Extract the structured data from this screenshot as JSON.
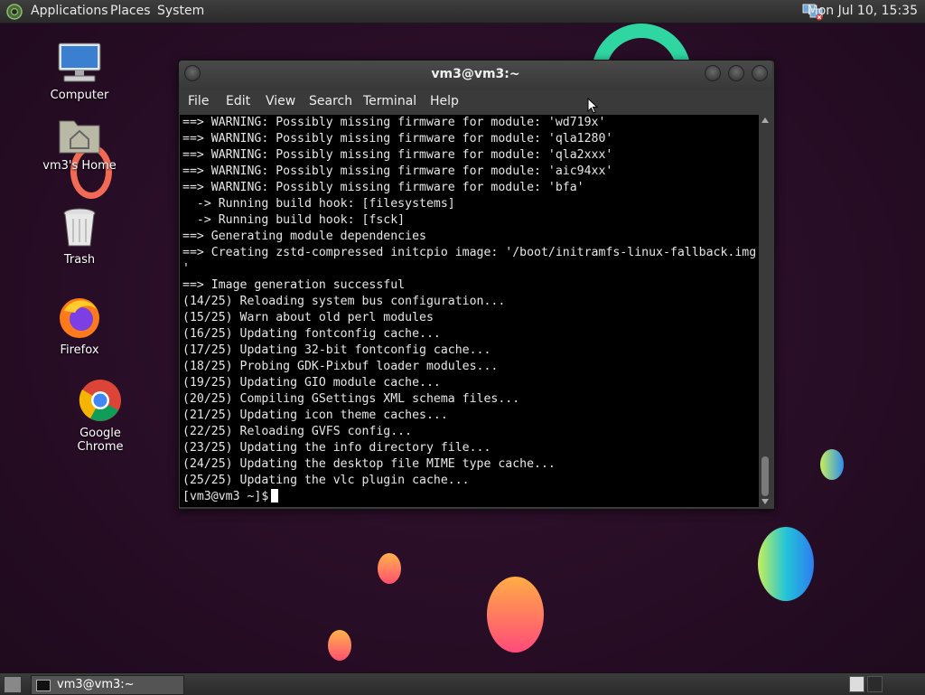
{
  "top_panel": {
    "menus": [
      "Applications",
      "Places",
      "System"
    ],
    "clock": "Mon Jul 10, 15:35"
  },
  "desktop_icons": [
    {
      "label": "Computer",
      "icon": "computer-icon"
    },
    {
      "label": "vm3's Home",
      "icon": "home-folder-icon"
    },
    {
      "label": "Trash",
      "icon": "trash-icon"
    },
    {
      "label": "Firefox",
      "icon": "firefox-icon"
    },
    {
      "label": "Google Chrome",
      "icon": "chrome-icon"
    }
  ],
  "terminal": {
    "title": "vm3@vm3:~",
    "menu": [
      "File",
      "Edit",
      "View",
      "Search",
      "Terminal",
      "Help"
    ],
    "lines": [
      "==> WARNING: Possibly missing firmware for module: 'wd719x'",
      "==> WARNING: Possibly missing firmware for module: 'qla1280'",
      "==> WARNING: Possibly missing firmware for module: 'qla2xxx'",
      "==> WARNING: Possibly missing firmware for module: 'aic94xx'",
      "==> WARNING: Possibly missing firmware for module: 'bfa'",
      "  -> Running build hook: [filesystems]",
      "  -> Running build hook: [fsck]",
      "==> Generating module dependencies",
      "==> Creating zstd-compressed initcpio image: '/boot/initramfs-linux-fallback.img",
      "'",
      "==> Image generation successful",
      "(14/25) Reloading system bus configuration...",
      "(15/25) Warn about old perl modules",
      "(16/25) Updating fontconfig cache...",
      "(17/25) Updating 32-bit fontconfig cache...",
      "(18/25) Probing GDK-Pixbuf loader modules...",
      "(19/25) Updating GIO module cache...",
      "(20/25) Compiling GSettings XML schema files...",
      "(21/25) Updating icon theme caches...",
      "(22/25) Reloading GVFS config...",
      "(23/25) Updating the info directory file...",
      "(24/25) Updating the desktop file MIME type cache...",
      "(25/25) Updating the vlc plugin cache..."
    ],
    "prompt": "[vm3@vm3 ~]$"
  },
  "taskbar": {
    "tasks": [
      "vm3@vm3:~"
    ]
  }
}
